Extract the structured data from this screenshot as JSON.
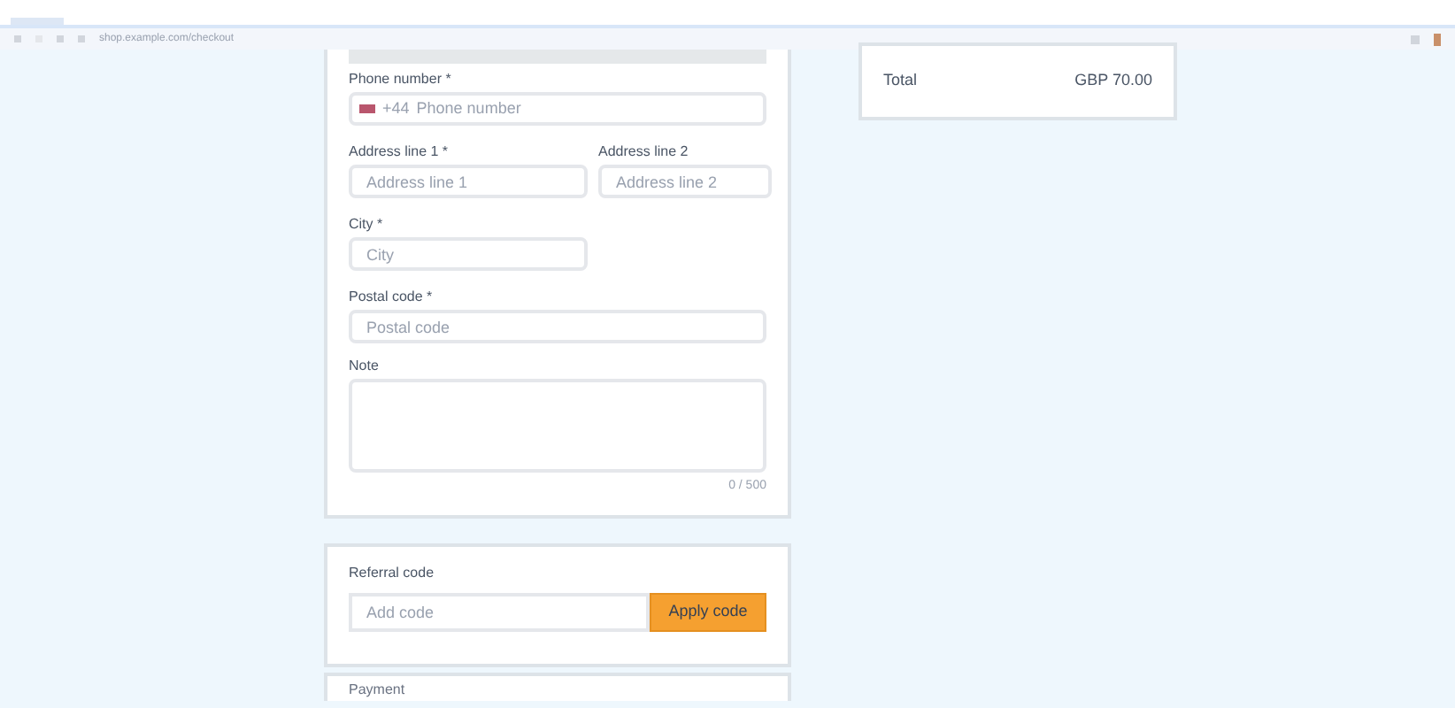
{
  "browser": {
    "url": "shop.example.com/checkout"
  },
  "contact_form": {
    "phone": {
      "label": "Phone number *",
      "country_code": "+44",
      "placeholder": "Phone number"
    },
    "address_line_1": {
      "label": "Address line 1 *",
      "placeholder": "Address line 1"
    },
    "address_line_2": {
      "label": "Address line 2",
      "placeholder": "Address line 2"
    },
    "city": {
      "label": "City *",
      "placeholder": "City"
    },
    "postal_code": {
      "label": "Postal code *",
      "placeholder": "Postal code"
    },
    "note": {
      "label": "Note",
      "counter": "0 / 500"
    }
  },
  "referral": {
    "label": "Referral code",
    "placeholder": "Add code",
    "button": "Apply code"
  },
  "next_section": {
    "title": "Payment"
  },
  "summary": {
    "label": "Total",
    "value": "GBP 70.00"
  }
}
